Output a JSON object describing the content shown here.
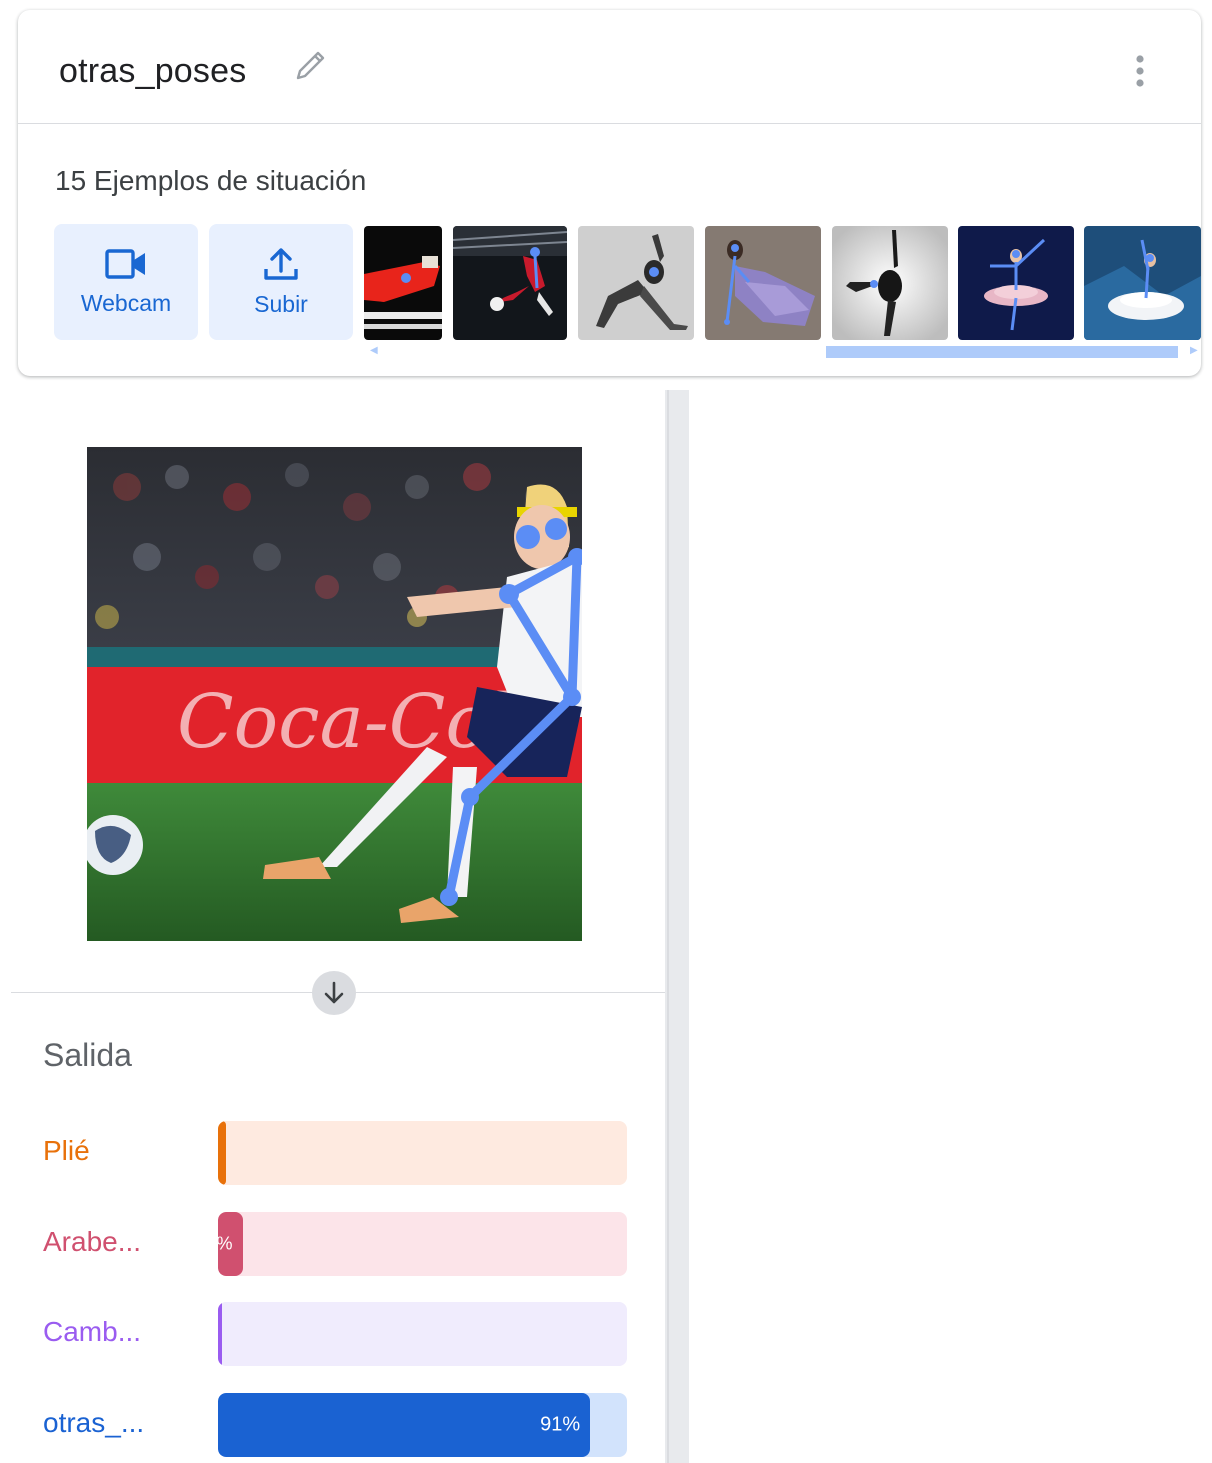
{
  "class_card": {
    "name": "otras_poses",
    "samples_label": "15 Ejemplos de situación",
    "webcam_label": "Webcam",
    "upload_label": "Subir",
    "thumbnails": [
      "gymnast-rings-thumb",
      "footballer-kick-thumb",
      "stretch-pose-thumb",
      "dancer-purple-dress-thumb",
      "ballet-leg-hold-thumb",
      "ballerina-pink-tutu-thumb",
      "ballerina-white-tutu-thumb"
    ]
  },
  "preview": {
    "image": "footballer-kicking-ball-with-pose-skeleton",
    "pose_color": "#5b8df5"
  },
  "output": {
    "title": "Salida",
    "classes": [
      {
        "label": "Plié",
        "percent": 2,
        "percent_text": "",
        "color": "#e8710a",
        "track_color": "#feeae0"
      },
      {
        "label": "Arabe...",
        "percent": 6,
        "percent_text": "%",
        "color": "#d0506f",
        "track_color": "#fce4e9"
      },
      {
        "label": "Camb...",
        "percent": 1,
        "percent_text": "",
        "color": "#9a5cf0",
        "track_color": "#f0ecfd"
      },
      {
        "label": "otras_...",
        "percent": 91,
        "percent_text": "91%",
        "color": "#1a62d2",
        "track_color": "#d2e3fc"
      }
    ]
  }
}
